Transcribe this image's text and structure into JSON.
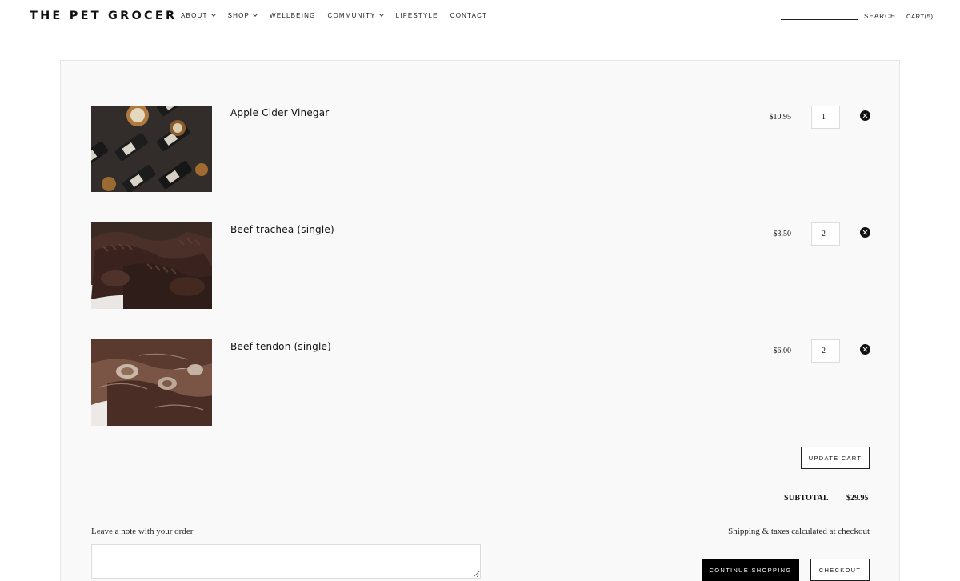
{
  "header": {
    "logo": "THE PET GROCER",
    "nav": [
      {
        "label": "ABOUT",
        "has_dropdown": true
      },
      {
        "label": "SHOP",
        "has_dropdown": true
      },
      {
        "label": "WELLBEING",
        "has_dropdown": false
      },
      {
        "label": "COMMUNITY",
        "has_dropdown": true
      },
      {
        "label": "LIFESTYLE",
        "has_dropdown": false
      },
      {
        "label": "CONTACT",
        "has_dropdown": false
      }
    ],
    "search_value": "",
    "search_label": "SEARCH",
    "cart_label": "CART(5)"
  },
  "cart": {
    "items": [
      {
        "title": "Apple Cider Vinegar",
        "price": "$10.95",
        "quantity": "1",
        "image": "bottles-jars-photo"
      },
      {
        "title": "Beef trachea (single)",
        "price": "$3.50",
        "quantity": "2",
        "image": "beef-trachea-photo"
      },
      {
        "title": "Beef tendon (single)",
        "price": "$6.00",
        "quantity": "2",
        "image": "beef-tendon-photo"
      }
    ],
    "update_label": "UPDATE CART",
    "subtotal_label": "SUBTOTAL",
    "subtotal_value": "$29.95",
    "note_label": "Leave a note with your order",
    "note_value": "",
    "shipping_text": "Shipping & taxes calculated at checkout",
    "continue_label": "CONTINUE SHOPPING",
    "checkout_label": "CHECKOUT"
  },
  "colors": {
    "panel_bg": "#f9f9f9",
    "panel_border": "#e6e6e6",
    "button_dark": "#000000",
    "text": "#111111"
  }
}
